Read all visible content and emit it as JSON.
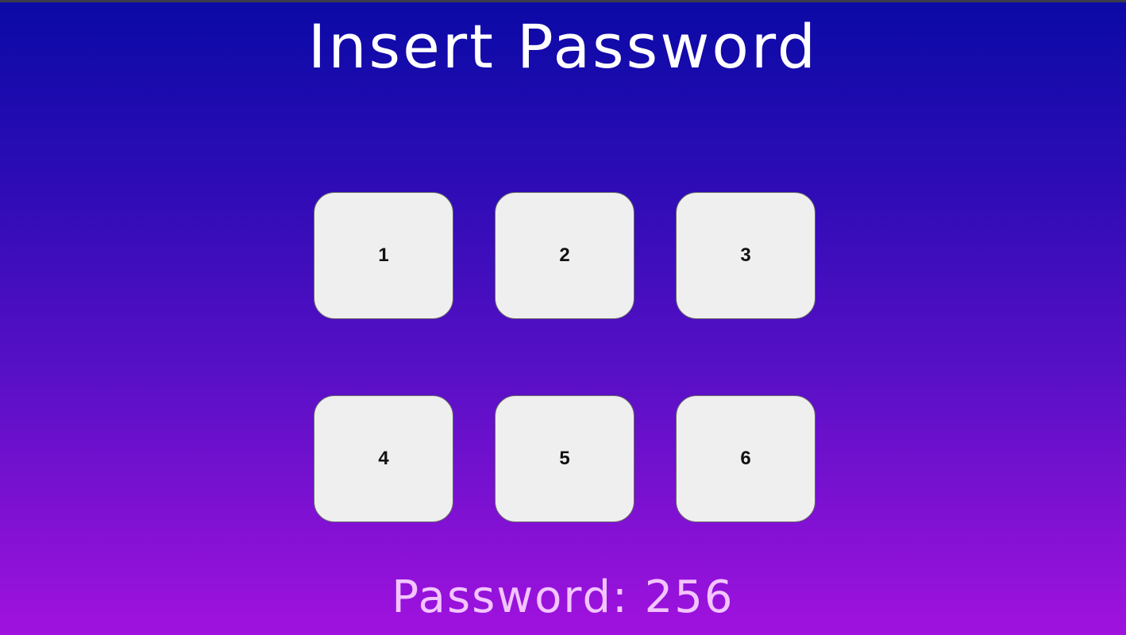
{
  "page": {
    "title": "Insert Password"
  },
  "keypad": {
    "keys": [
      "1",
      "2",
      "3",
      "4",
      "5",
      "6"
    ]
  },
  "password": {
    "label": "Password:",
    "value": "256"
  },
  "colors": {
    "gradient_top": "#0a0aa6",
    "gradient_bottom": "#a012de",
    "title_text": "#ffffff",
    "password_text": "#f3c4ff",
    "key_background": "#efefef"
  }
}
